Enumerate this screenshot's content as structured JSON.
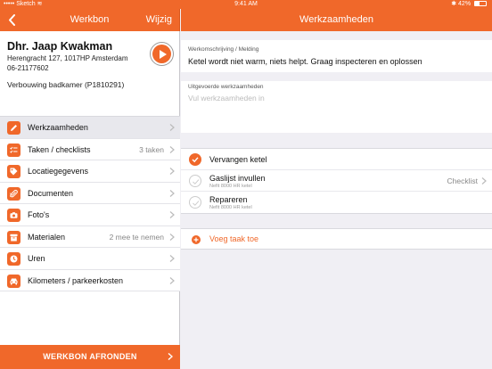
{
  "status_bar": {
    "carrier": "Sketch",
    "time": "9:41 AM",
    "battery": "42%",
    "battery_level": 0.42
  },
  "left_nav": {
    "title": "Werkbon",
    "action": "Wijzig"
  },
  "right_nav": {
    "title": "Werkzaamheden"
  },
  "customer": {
    "name": "Dhr. Jaap Kwakman",
    "address": "Herengracht 127, 1017HP Amsterdam",
    "phone": "06-21177602",
    "project": "Verbouwing badkamer (P1810291)"
  },
  "menu": {
    "items": [
      {
        "label": "Werkzaamheden",
        "meta": "",
        "icon": "pencil-icon"
      },
      {
        "label": "Taken / checklists",
        "meta": "3 taken",
        "icon": "checklist-icon"
      },
      {
        "label": "Locatiegegevens",
        "meta": "",
        "icon": "tag-icon"
      },
      {
        "label": "Documenten",
        "meta": "",
        "icon": "paperclip-icon"
      },
      {
        "label": "Foto's",
        "meta": "",
        "icon": "camera-icon"
      },
      {
        "label": "Materialen",
        "meta": "2 mee te nemen",
        "icon": "box-icon"
      },
      {
        "label": "Uren",
        "meta": "",
        "icon": "clock-icon"
      },
      {
        "label": "Kilometers / parkeerkosten",
        "meta": "",
        "icon": "car-icon"
      }
    ]
  },
  "finish_button": "WERKBON AFRONDEN",
  "description": {
    "label": "Werkomschrijving / Melding",
    "text": "Ketel wordt niet warm, niets helpt. Graag inspecteren en oplossen"
  },
  "work_done": {
    "label": "Uitgevoerde werkzaamheden",
    "placeholder": "Vul werkzaamheden in"
  },
  "tasks": [
    {
      "title": "Vervangen ketel",
      "sub": "",
      "meta": "",
      "done": true
    },
    {
      "title": "Gaslijst invullen",
      "sub": "Nefit 8000 HR ketel",
      "meta": "Checklist",
      "done": false
    },
    {
      "title": "Repareren",
      "sub": "Nefit 8000 HR ketel",
      "meta": "",
      "done": false
    }
  ],
  "add_task": "Voeg taak toe",
  "colors": {
    "accent": "#f0682a"
  }
}
